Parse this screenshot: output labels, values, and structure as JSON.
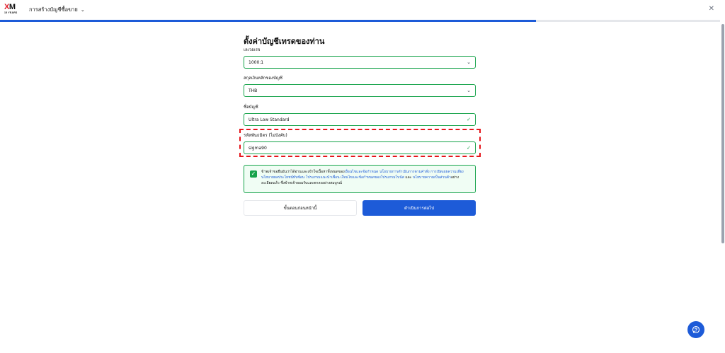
{
  "header": {
    "logo_text_xm_x": "X",
    "logo_text_xm_m": "M",
    "logo_subtext": "15 YEARS",
    "app_menu_label": "การสร้างบัญชีซื้อขาย",
    "progress_fraction": 0.744
  },
  "form": {
    "title": "ตั้งค่าบัญชีเทรดของท่าน",
    "leverage": {
      "label": "เลเวอเรจ",
      "value": "1000:1"
    },
    "currency": {
      "label": "สกุลเงินหลักของบัญชี",
      "value": "THB"
    },
    "account_type": {
      "label": "ชื่อบัญชี",
      "value": "Ultra Low Standard"
    },
    "promo_code": {
      "label": "รหัสพันธมิตร (ไม่บังคับ)",
      "value": "sigma90"
    },
    "terms": {
      "t1": "ข้าพเจ้าขอยืนยันว่าได้อ่านและเข้าใจเนื้อหาทั้งหมดของ",
      "l1": "เงื่อนไขและข้อกำหนด",
      "t2": " ",
      "l2": "นโยบายการดำเนินการตามคำสั่ง",
      "t3": " ",
      "l3": "การเปิดเผยความเสี่ยง",
      "t4": " ",
      "l4": "นโยบายผลประโยชน์ทับซ้อน",
      "t5": " ",
      "l5": "โปรแกรมแนะนำเพื่อน",
      "t6": " ",
      "l6": "เงื่อนไขและข้อกำหนดของโปรแกรมโบนัส",
      "t7": " และ ",
      "l7": "นโยบายความเป็นส่วนตัว",
      "t8": "อย่างละเอียดแล้ว ซึ่งข้าพเจ้ายอมรับและตกลงอย่างสมบูรณ์"
    },
    "back_label": "ขั้นตอนก่อนหน้านี้",
    "next_label": "ดำเนินการต่อไป"
  }
}
